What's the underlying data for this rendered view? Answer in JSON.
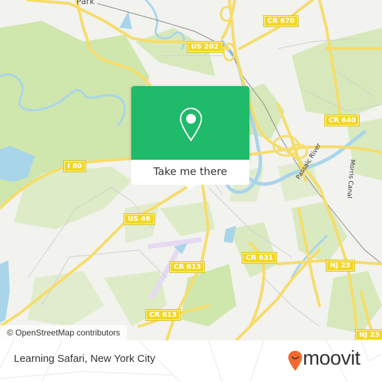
{
  "map": {
    "place_labels": [
      {
        "name": "Park"
      }
    ],
    "road_shields": [
      {
        "label": "CR 670"
      },
      {
        "label": "US 202"
      },
      {
        "label": "CR 640"
      },
      {
        "label": "I 80"
      },
      {
        "label": "US 46"
      },
      {
        "label": "CR 613"
      },
      {
        "label": "CR 631"
      },
      {
        "label": "NJ 23"
      },
      {
        "label": "CR 613"
      },
      {
        "label": "NJ 23"
      }
    ],
    "water_labels": [
      {
        "name": "Passaic River"
      },
      {
        "name": "Morris Canal"
      }
    ],
    "colors": {
      "land": "#f2f2ee",
      "park": "#cfe6ad",
      "water": "#a8d5ea",
      "road": "#f6dc6a",
      "popup_green": "#1fba6a"
    }
  },
  "popup": {
    "icon": "map-pin-icon",
    "button_label": "Take me there"
  },
  "attribution": "© OpenStreetMap contributors",
  "footer": {
    "title": "Learning Safari, New York City",
    "logo_text": "moovit",
    "logo_color": "#f26a31"
  }
}
